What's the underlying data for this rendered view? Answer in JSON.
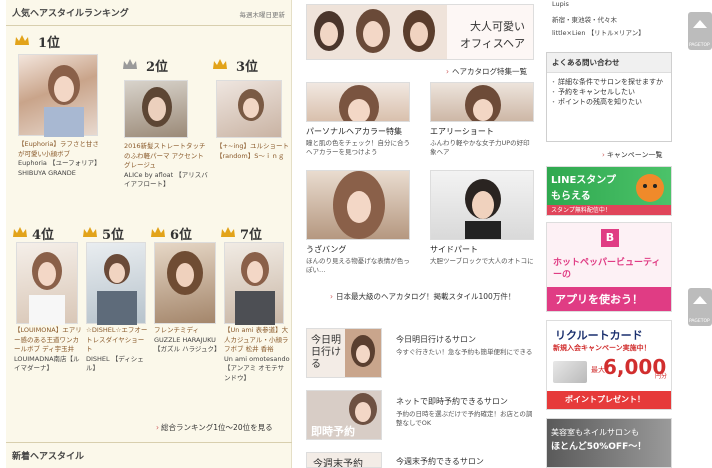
{
  "ranking": {
    "title": "人気ヘアスタイルランキング",
    "note": "毎週木曜日更新",
    "items": [
      {
        "rank": "1位",
        "caption": "【Euphoria】ラフさと甘さが可愛い小顔ボブ",
        "salon": "Euphoria 【ユーフォリア】 SHIBUYA GRANDE"
      },
      {
        "rank": "2位",
        "caption": "2016新髪ストレートタッチのふわ軽パーマ アクセントグレージュ",
        "salon": "ALICe by afloat 【アリスバイアフロート】"
      },
      {
        "rank": "3位",
        "caption": "【+~ing】ユルショート【random】S～ｉｎｇ",
        "salon": ""
      },
      {
        "rank": "4位",
        "caption": "【LOUIMONA】エアリー感のある王道ワンカールボブ ディ宇玉井",
        "salon": "LOUIMADNA南店【ルイマダーナ】"
      },
      {
        "rank": "5位",
        "caption": "☆DISHEL☆エフオートレスダイヤショート",
        "salon": "DISHEL 【ディシェル】"
      },
      {
        "rank": "6位",
        "caption": "フレンチミディ",
        "salon": "GUZZLE HARAJUKU 【ガズル ハラジュク】"
      },
      {
        "rank": "7位",
        "caption": "【Un ami 表参道】大人カジュアル・小顔ラフボブ 松井 香裕",
        "salon": "Un ami omotesando 【アンアミ オモテサンドウ】"
      }
    ],
    "more_link": "総合ランキング1位～20位を見る"
  },
  "new_styles_title": "新着ヘアスタイル",
  "catalog": {
    "banner_line1": "大人可愛い",
    "banner_line2": "オフィスヘア",
    "feature_link": "ヘアカタログ特集一覧",
    "cards": [
      {
        "title": "パーソナルヘアカラー特集",
        "desc": "瞳と肌の色をチェック！自分に合うヘアカラーを見つけよう"
      },
      {
        "title": "エアリーショート",
        "desc": "ふんわり軽やかな女子力UPの好印象ヘア"
      },
      {
        "title": "うざバング",
        "desc": "ほんのり見える物憂げな表情が色っぽい…"
      },
      {
        "title": "サイドパート",
        "desc": "大胆ツーブロックで大人のオトコに"
      }
    ],
    "bottom_link": "日本最大級のヘアカタログ！掲載スタイル100万件！"
  },
  "salon_rows": [
    {
      "thumb": "今日明日行ける",
      "title": "今日明日行けるサロン",
      "desc": "今すぐ行きたい！急な予約も簡単便利にできる"
    },
    {
      "thumb": "即時予約",
      "title": "ネットで即時予約できるサロン",
      "desc": "予約の日時を選ぶだけで予約確定！お店との調整なしでOK"
    },
    {
      "thumb": "今週末予約",
      "title": "今週末予約できるサロン",
      "desc": ""
    }
  ],
  "sidebar": {
    "top_line1": "Lupis",
    "top_line2": "新宿・東池袋・代々木",
    "top_line3": "little×Lien 【リトル×リアン】",
    "faq_title": "よくある問い合わせ",
    "faq_items": [
      "詳細な条件でサロンを探せますか",
      "予約をキャンセルしたい",
      "ポイントの残高を知りたい"
    ],
    "campaign_link": "キャンペーン一覧",
    "line_ad": {
      "title": "LINEスタンプ",
      "sub": "もらえる",
      "foot": "スタンプ無料配信中！"
    },
    "hp_ad": {
      "brand": "ホットペッパービューティーの",
      "cta": "アプリを使おう！"
    },
    "card_ad": {
      "title": "リクルートカード",
      "sub": "新規入会キャンペーン実施中！",
      "max": "最大",
      "amount": "6,000",
      "unit": "円分",
      "foot": "ポイントプレゼント！"
    },
    "nail_ad": {
      "line1": "美容室もネイルサロンも",
      "line2": "ほとんど50%OFF～！"
    }
  },
  "pagetop_label": "PAGETOP",
  "colors": {
    "accent": "#c55555",
    "crown_gold": "#e2a31a",
    "crown_silver": "#9a9a9a",
    "line_green": "#2fa84f",
    "hp_pink": "#e03c84"
  }
}
